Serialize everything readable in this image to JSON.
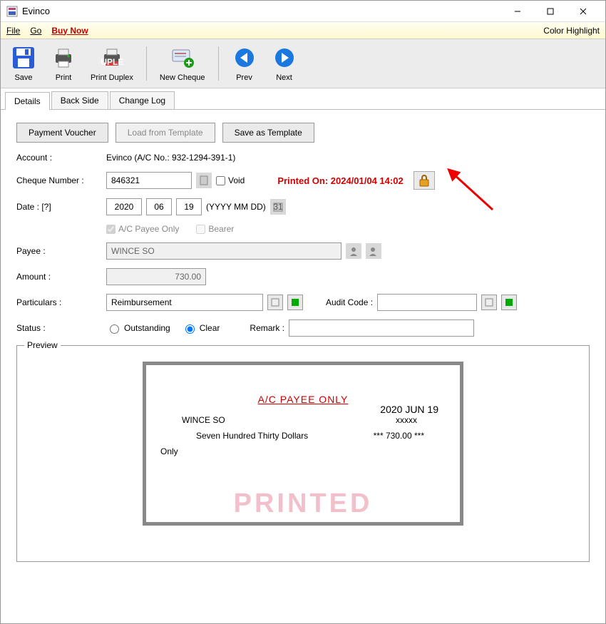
{
  "title": "Evinco",
  "menubar": {
    "file": "File",
    "go": "Go",
    "buy_now": "Buy Now",
    "color_highlight": "Color Highlight"
  },
  "toolbar": {
    "save": "Save",
    "print": "Print",
    "print_duplex": "Print Duplex",
    "new_cheque": "New Cheque",
    "prev": "Prev",
    "next": "Next"
  },
  "tabs": {
    "details": "Details",
    "back_side": "Back Side",
    "change_log": "Change Log"
  },
  "buttons": {
    "payment_voucher": "Payment Voucher",
    "load_template": "Load from Template",
    "save_template": "Save as Template"
  },
  "form": {
    "account_label": "Account :",
    "account_value": "Evinco (A/C No.: 932-1294-391-1)",
    "cheque_number_label": "Cheque Number :",
    "cheque_number": "846321",
    "void_label": "Void",
    "printed_on": "Printed On: 2024/01/04 14:02",
    "date_label": "Date : [?]",
    "date_y": "2020",
    "date_m": "06",
    "date_d": "19",
    "date_fmt": "(YYYY MM DD)",
    "ac_payee_only": "A/C Payee Only",
    "bearer": "Bearer",
    "payee_label": "Payee :",
    "payee": "WINCE SO",
    "amount_label": "Amount :",
    "amount": "730.00",
    "particulars_label": "Particulars :",
    "particulars": "Reimbursement",
    "audit_code_label": "Audit Code :",
    "audit_code": "",
    "status_label": "Status :",
    "outstanding": "Outstanding",
    "clear": "Clear",
    "remark_label": "Remark :",
    "remark": ""
  },
  "preview": {
    "legend": "Preview",
    "ac_payee": "A/C PAYEE ONLY",
    "date": "2020 JUN 19",
    "payee": "WINCE SO",
    "xxxxx": "xxxxx",
    "words": "Seven Hundred Thirty Dollars",
    "amount": "*** 730.00 ***",
    "only": "Only",
    "printed": "PRINTED"
  }
}
